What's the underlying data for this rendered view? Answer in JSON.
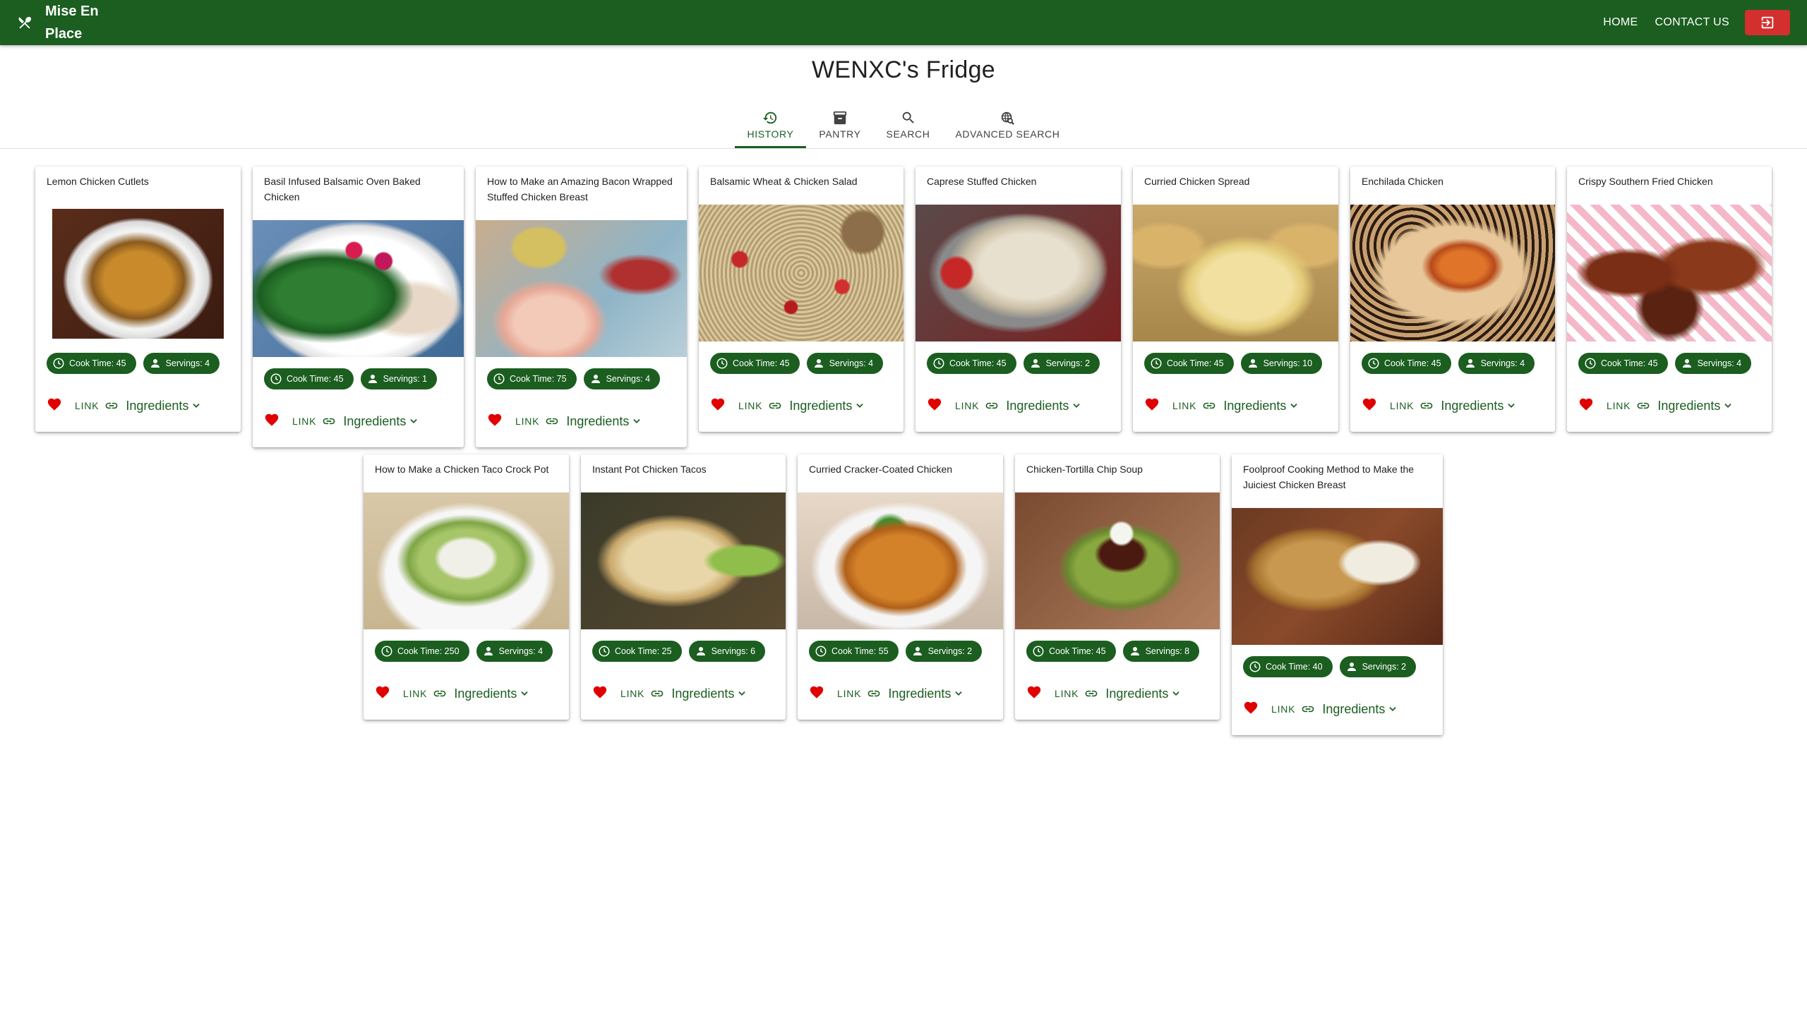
{
  "app": {
    "brand": "Mise En Place",
    "nav": {
      "home": "HOME",
      "contact": "CONTACT US"
    },
    "colors": {
      "primary": "#1b5e20",
      "danger": "#d32f2f",
      "heart": "#e00000"
    }
  },
  "page": {
    "title": "WENXC's Fridge"
  },
  "tabs": [
    {
      "label": "HISTORY",
      "icon": "history-icon",
      "active": true
    },
    {
      "label": "PANTRY",
      "icon": "archive-icon",
      "active": false
    },
    {
      "label": "SEARCH",
      "icon": "search-icon",
      "active": false
    },
    {
      "label": "ADVANCED SEARCH",
      "icon": "globe-search-icon",
      "active": false
    }
  ],
  "labels": {
    "link": "LINK",
    "ingredients": "Ingredients"
  },
  "recipes": [
    {
      "title": "Lemon Chicken Cutlets",
      "cook_time": "Cook Time: 45",
      "servings": "Servings: 4"
    },
    {
      "title": "Basil Infused Balsamic Oven Baked Chicken",
      "cook_time": "Cook Time: 45",
      "servings": "Servings: 1"
    },
    {
      "title": "How to Make an Amazing Bacon Wrapped Stuffed Chicken Breast",
      "cook_time": "Cook Time: 75",
      "servings": "Servings: 4"
    },
    {
      "title": "Balsamic Wheat & Chicken Salad",
      "cook_time": "Cook Time: 45",
      "servings": "Servings: 4"
    },
    {
      "title": "Caprese Stuffed Chicken",
      "cook_time": "Cook Time: 45",
      "servings": "Servings: 2"
    },
    {
      "title": "Curried Chicken Spread",
      "cook_time": "Cook Time: 45",
      "servings": "Servings: 10"
    },
    {
      "title": "Enchilada Chicken",
      "cook_time": "Cook Time: 45",
      "servings": "Servings: 4"
    },
    {
      "title": "Crispy Southern Fried Chicken",
      "cook_time": "Cook Time: 45",
      "servings": "Servings: 4"
    },
    {
      "title": "How to Make a Chicken Taco Crock Pot",
      "cook_time": "Cook Time: 250",
      "servings": "Servings: 4"
    },
    {
      "title": "Instant Pot Chicken Tacos",
      "cook_time": "Cook Time: 25",
      "servings": "Servings: 6"
    },
    {
      "title": "Curried Cracker-Coated Chicken",
      "cook_time": "Cook Time: 55",
      "servings": "Servings: 2"
    },
    {
      "title": "Chicken-Tortilla Chip Soup",
      "cook_time": "Cook Time: 45",
      "servings": "Servings: 8"
    },
    {
      "title": "Foolproof Cooking Method to Make the Juiciest Chicken Breast",
      "cook_time": "Cook Time: 40",
      "servings": "Servings: 2"
    }
  ]
}
